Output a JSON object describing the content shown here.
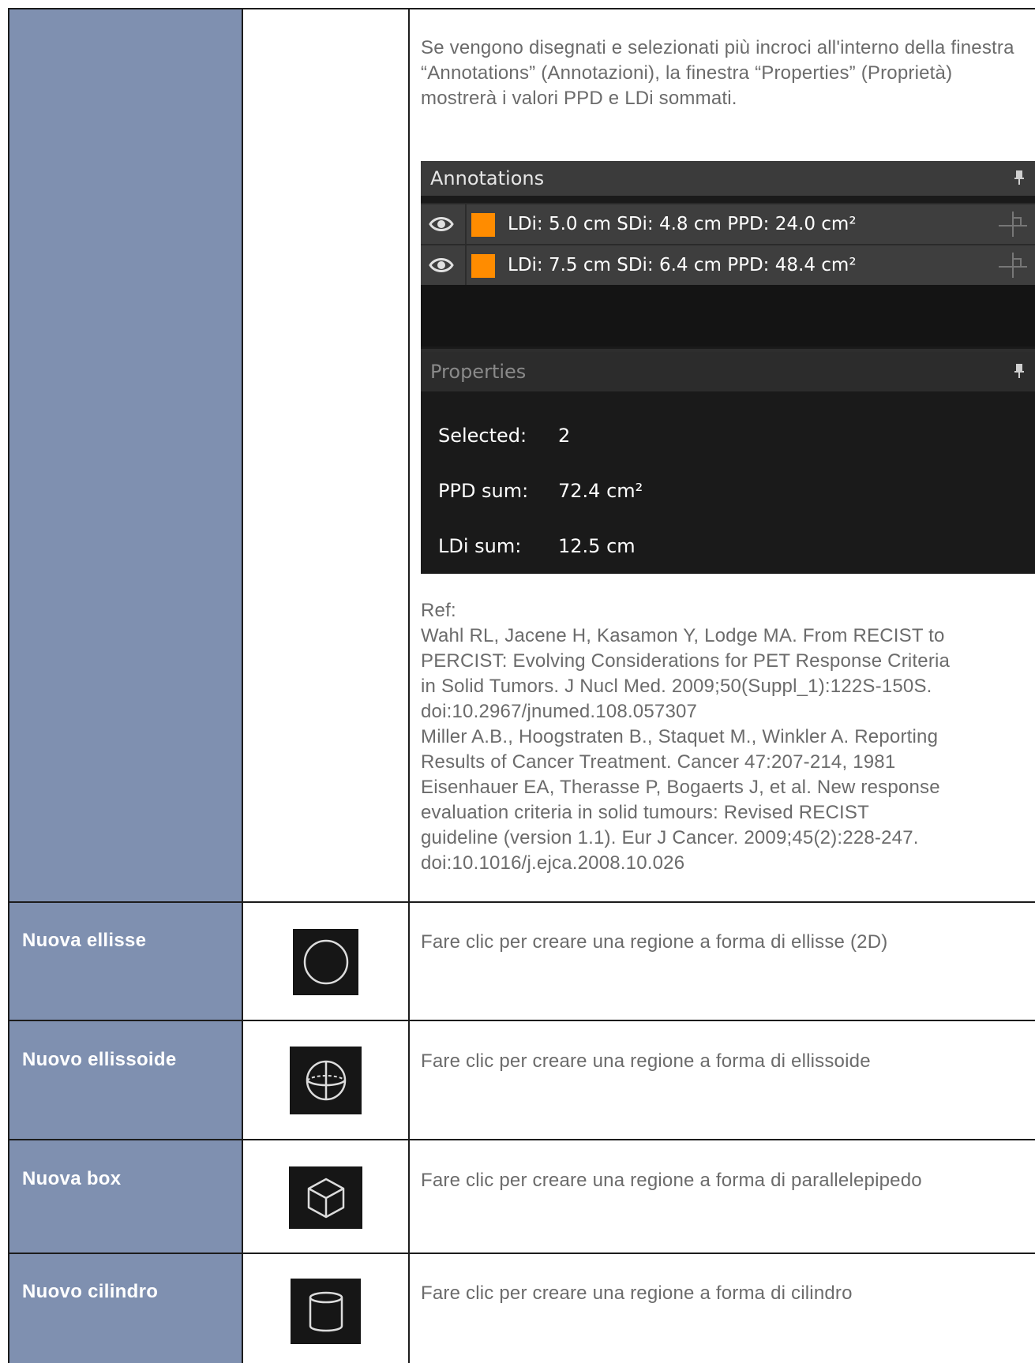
{
  "top_section": {
    "intro": "Se vengono disegnati e selezionati più incroci all'interno della finestra “Annotations” (Annotazioni), la finestra “Properties” (Proprietà) mostrerà i valori PPD e LDi sommati.",
    "screenshot": {
      "annotations_title": "Annotations",
      "annotations": [
        {
          "text": "LDi: 5.0 cm SDi: 4.8 cm PPD: 24.0 cm²",
          "color": "#FF8C00"
        },
        {
          "text": "LDi: 7.5 cm SDi: 6.4 cm PPD: 48.4 cm²",
          "color": "#FF8C00"
        }
      ],
      "properties_title": "Properties",
      "properties": [
        {
          "label": "Selected:",
          "value": "2"
        },
        {
          "label": "PPD sum:",
          "value": "72.4 cm²"
        },
        {
          "label": "LDi sum:",
          "value": "12.5 cm"
        }
      ]
    },
    "refs": [
      "Ref:",
      "Wahl RL, Jacene H, Kasamon Y, Lodge MA. From RECIST to",
      "PERCIST: Evolving Considerations for PET Response Criteria",
      "in Solid Tumors. J Nucl Med. 2009;50(Suppl_1):122S-150S.",
      "doi:10.2967/jnumed.108.057307",
      "Miller A.B., Hoogstraten B., Staquet M., Winkler A. Reporting",
      "Results of Cancer Treatment. Cancer 47:207-214, 1981",
      "Eisenhauer EA, Therasse P, Bogaerts J, et al. New response",
      "evaluation criteria in solid tumours: Revised RECIST",
      "guideline (version 1.1). Eur J Cancer. 2009;45(2):228-247.",
      "doi:10.1016/j.ejca.2008.10.026"
    ]
  },
  "rows": [
    {
      "label": "Nuova ellisse",
      "icon": "ellipse-icon",
      "description": "Fare clic per creare una regione a forma di ellisse (2D)"
    },
    {
      "label": "Nuovo ellissoide",
      "icon": "ellipsoid-icon",
      "description": "Fare clic per creare una regione a forma di ellissoide"
    },
    {
      "label": "Nuova box",
      "icon": "box-icon",
      "description": "Fare clic per creare una regione a forma di parallelepipedo"
    },
    {
      "label": "Nuovo cilindro",
      "icon": "cylinder-icon",
      "description": "Fare clic per creare una regione a forma di cilindro"
    }
  ],
  "colors": {
    "label_column": "#7F90B0",
    "annotation_swatch": "#FF8C00",
    "panel_bg": "#1A1A1A"
  }
}
